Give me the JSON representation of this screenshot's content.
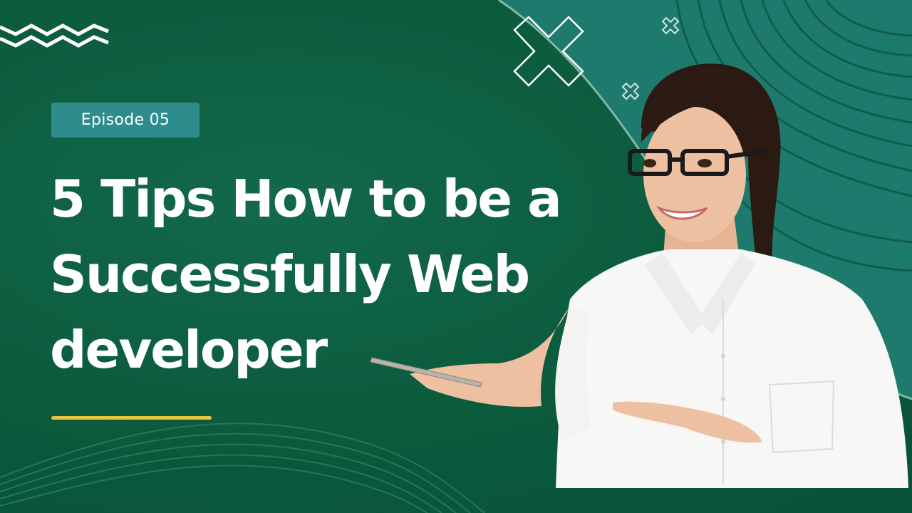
{
  "badge": {
    "label": "Episode 05"
  },
  "title": {
    "lines": [
      "5 Tips How to be a",
      "Successfully Web",
      "developer"
    ]
  },
  "colors": {
    "background": "#0b5a3c",
    "panel": "#1e7a6c",
    "badge": "#2e8c8c",
    "accent_line": "#e7c23c",
    "text": "#ffffff"
  },
  "icons": [
    "zigzag-icon",
    "close-x-icon",
    "wave-lines-icon"
  ]
}
